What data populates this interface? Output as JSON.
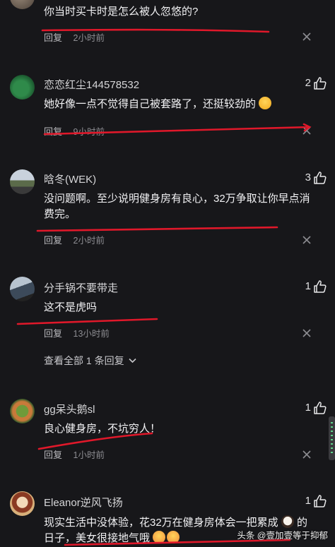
{
  "comments": [
    {
      "text": "你当时买卡时是怎么被人忽悠的?",
      "reply_label": "回复",
      "time": "2小时前"
    },
    {
      "username": "恋恋红尘144578532",
      "likes": "2",
      "text": "她好像一点不觉得自己被套路了，还挺较劲的",
      "reply_label": "回复",
      "time": "9小时前"
    },
    {
      "username": "晗冬(WEK)",
      "likes": "3",
      "text": "没问题啊。至少说明健身房有良心，32万争取让你早点消费完。",
      "reply_label": "回复",
      "time": "2小时前"
    },
    {
      "username": "分手锅不要带走",
      "likes": "1",
      "text": "这不是虎吗",
      "reply_label": "回复",
      "time": "13小时前",
      "expand_label": "查看全部 1 条回复"
    },
    {
      "username": "gg呆头鹅sl",
      "likes": "1",
      "text": "良心健身房，不坑穷人！",
      "reply_label": "回复",
      "time": "1小时前"
    },
    {
      "username": "Eleanor逆风飞扬",
      "likes": "1",
      "text_part1": "现实生活中没体验，花32万在健身房体会一把累成",
      "text_part2": "的",
      "text_part3": "日子，美女很接地气哦"
    }
  ],
  "watermark": "头条 @壹加壹等于抑郁",
  "colors": {
    "background": "#17171a",
    "annotation_red": "#e0182a",
    "muted_text": "#8d8d92"
  },
  "icons": [
    "thumb-up-icon",
    "close-icon",
    "chevron-down-icon",
    "grin-emoji-icon",
    "crying-face-emoji-icon",
    "laughing-emoji-icon"
  ]
}
